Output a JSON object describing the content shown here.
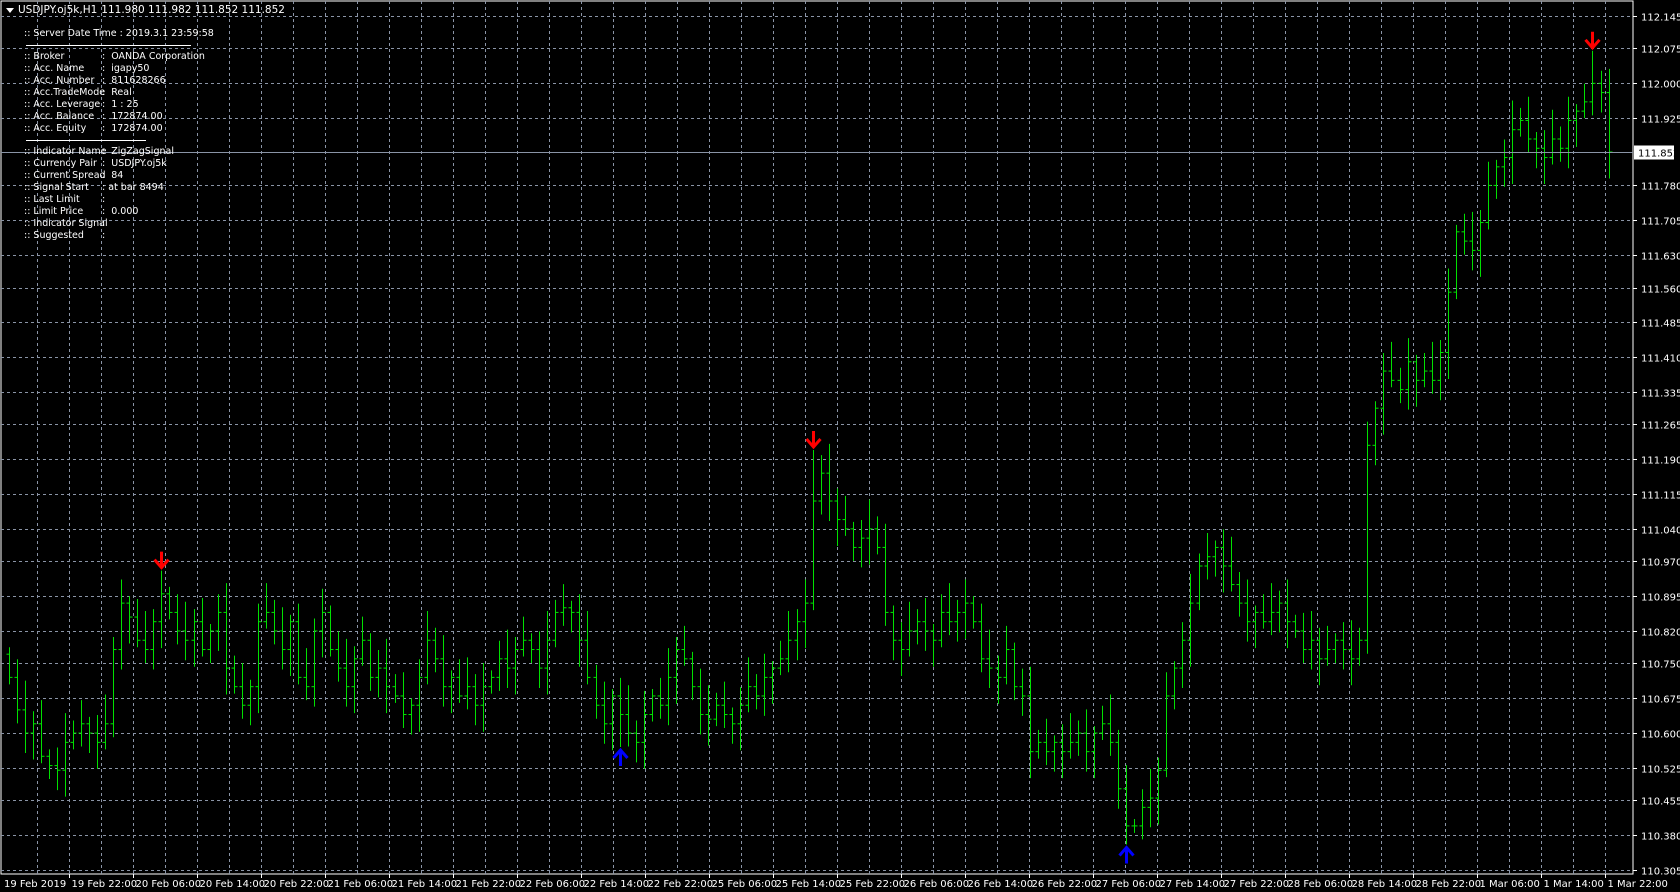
{
  "header": {
    "symbol": "USDJPY.oj5k,H1",
    "ohlc": "111.980 111.982 111.852 111.852"
  },
  "info_panel": {
    "server_time": ":: Server Date Time : 2019.3.1    23:59:58",
    "account_rows": [
      {
        "label": ":: Broker",
        "value": ":  OANDA Corporation"
      },
      {
        "label": ":: Acc. Name",
        "value": ":  igapy50"
      },
      {
        "label": ":: Acc. Number",
        "value": ":  811628266"
      },
      {
        "label": ":: Acc.TradeMode",
        "value": ":  Real"
      },
      {
        "label": ":: Acc. Leverage",
        "value": ":  1 : 25"
      },
      {
        "label": ":: Acc. Balance",
        "value": ":  172874.00"
      },
      {
        "label": ":: Acc. Equity",
        "value": ":  172874.00"
      }
    ],
    "indicator_rows": [
      {
        "label": ":: Indicator Name",
        "value": ":  ZigZagSignal"
      },
      {
        "label": ":: Currency Pair",
        "value": ":  USDJPY.oj5k"
      },
      {
        "label": ":: Current Spread",
        "value": ":  84"
      },
      {
        "label": ":: Signal Start",
        "value": ": at bar 8494"
      },
      {
        "label": ":: Last Limit",
        "value": ":"
      },
      {
        "label": ":: Limit Price",
        "value": ":  0.000"
      },
      {
        "label": ":: Indicator Signal",
        "value": ":"
      },
      {
        "label": ":: Suggested",
        "value": ":"
      }
    ]
  },
  "colors": {
    "bar": "#00e000",
    "grid": "#8a94a6",
    "sell": "#ff0000",
    "buy": "#0000ff",
    "current_line": "#8a94a6"
  },
  "chart_data": {
    "type": "ohlc-bar",
    "title": "USDJPY.oj5k,H1",
    "timeframe": "H1",
    "y_ticks": [
      "112.145",
      "112.075",
      "112.000",
      "111.925",
      "111.780",
      "111.705",
      "111.630",
      "111.560",
      "111.485",
      "111.410",
      "111.335",
      "111.265",
      "111.190",
      "111.115",
      "111.040",
      "110.970",
      "110.895",
      "110.820",
      "110.750",
      "110.675",
      "110.600",
      "110.525",
      "110.455",
      "110.380",
      "110.305"
    ],
    "ylim": [
      110.305,
      112.145
    ],
    "current_price": "111.852",
    "x_ticks": [
      "19 Feb 2019",
      "19 Feb 22:00",
      "20 Feb 06:00",
      "20 Feb 14:00",
      "20 Feb 22:00",
      "21 Feb 06:00",
      "21 Feb 14:00",
      "21 Feb 22:00",
      "22 Feb 06:00",
      "22 Feb 14:00",
      "22 Feb 22:00",
      "25 Feb 06:00",
      "25 Feb 14:00",
      "25 Feb 22:00",
      "26 Feb 06:00",
      "26 Feb 14:00",
      "26 Feb 22:00",
      "27 Feb 06:00",
      "27 Feb 14:00",
      "27 Feb 22:00",
      "28 Feb 06:00",
      "28 Feb 14:00",
      "28 Feb 22:00",
      "1 Mar 06:00",
      "1 Mar 14:00",
      "1 Mar 22:00"
    ],
    "closes": [
      110.72,
      110.65,
      110.6,
      110.62,
      110.55,
      110.53,
      110.52,
      110.58,
      110.6,
      110.62,
      110.6,
      110.58,
      110.62,
      110.78,
      110.88,
      110.85,
      110.8,
      110.78,
      110.84,
      110.9,
      110.86,
      110.82,
      110.8,
      110.84,
      110.78,
      110.82,
      110.86,
      110.74,
      110.7,
      110.66,
      110.7,
      110.84,
      110.86,
      110.82,
      110.78,
      110.84,
      110.72,
      110.7,
      110.82,
      110.86,
      110.78,
      110.74,
      110.7,
      110.76,
      110.8,
      110.72,
      110.74,
      110.7,
      110.68,
      110.64,
      110.66,
      110.72,
      110.8,
      110.76,
      110.7,
      110.72,
      110.68,
      110.7,
      110.66,
      110.7,
      110.72,
      110.76,
      110.74,
      110.78,
      110.8,
      110.78,
      110.74,
      110.8,
      110.86,
      110.87,
      110.86,
      110.8,
      110.72,
      110.66,
      110.62,
      110.68,
      110.64,
      110.6,
      110.58,
      110.64,
      110.68,
      110.66,
      110.72,
      110.78,
      110.76,
      110.7,
      110.64,
      110.63,
      110.66,
      110.64,
      110.62,
      110.66,
      110.7,
      110.68,
      110.72,
      110.74,
      110.76,
      110.8,
      110.84,
      110.88,
      111.1,
      111.16,
      111.1,
      111.06,
      111.04,
      111.0,
      111.02,
      111.04,
      111.0,
      110.86,
      110.8,
      110.78,
      110.82,
      110.84,
      110.82,
      110.8,
      110.86,
      110.84,
      110.86,
      110.88,
      110.84,
      110.76,
      110.74,
      110.72,
      110.78,
      110.7,
      110.68,
      110.56,
      110.58,
      110.56,
      110.58,
      110.56,
      110.58,
      110.6,
      110.56,
      110.6,
      110.62,
      110.58,
      110.48,
      110.4,
      110.4,
      110.44,
      110.46,
      110.52,
      110.68,
      110.74,
      110.8,
      110.88,
      110.96,
      110.98,
      111.0,
      110.96,
      110.92,
      110.88,
      110.84,
      110.86,
      110.84,
      110.86,
      110.88,
      110.84,
      110.82,
      110.78,
      110.8,
      110.76,
      110.78,
      110.8,
      110.78,
      110.76,
      110.8,
      111.22,
      111.3,
      111.38,
      111.36,
      111.34,
      111.4,
      111.36,
      111.38,
      111.36,
      111.42,
      111.55,
      111.68,
      111.66,
      111.64,
      111.7,
      111.78,
      111.82,
      111.84,
      111.9,
      111.92,
      111.88,
      111.86,
      111.84,
      111.88,
      111.86,
      111.92,
      111.94,
      111.96,
      112.0,
      111.98,
      111.852
    ],
    "signals": [
      {
        "bar": 19,
        "type": "sell",
        "price": 110.95
      },
      {
        "bar": 76,
        "type": "buy",
        "price": 110.57
      },
      {
        "bar": 100,
        "type": "sell",
        "price": 111.21
      },
      {
        "bar": 139,
        "type": "buy",
        "price": 110.36
      },
      {
        "bar": 197,
        "type": "sell",
        "price": 112.07
      }
    ]
  }
}
